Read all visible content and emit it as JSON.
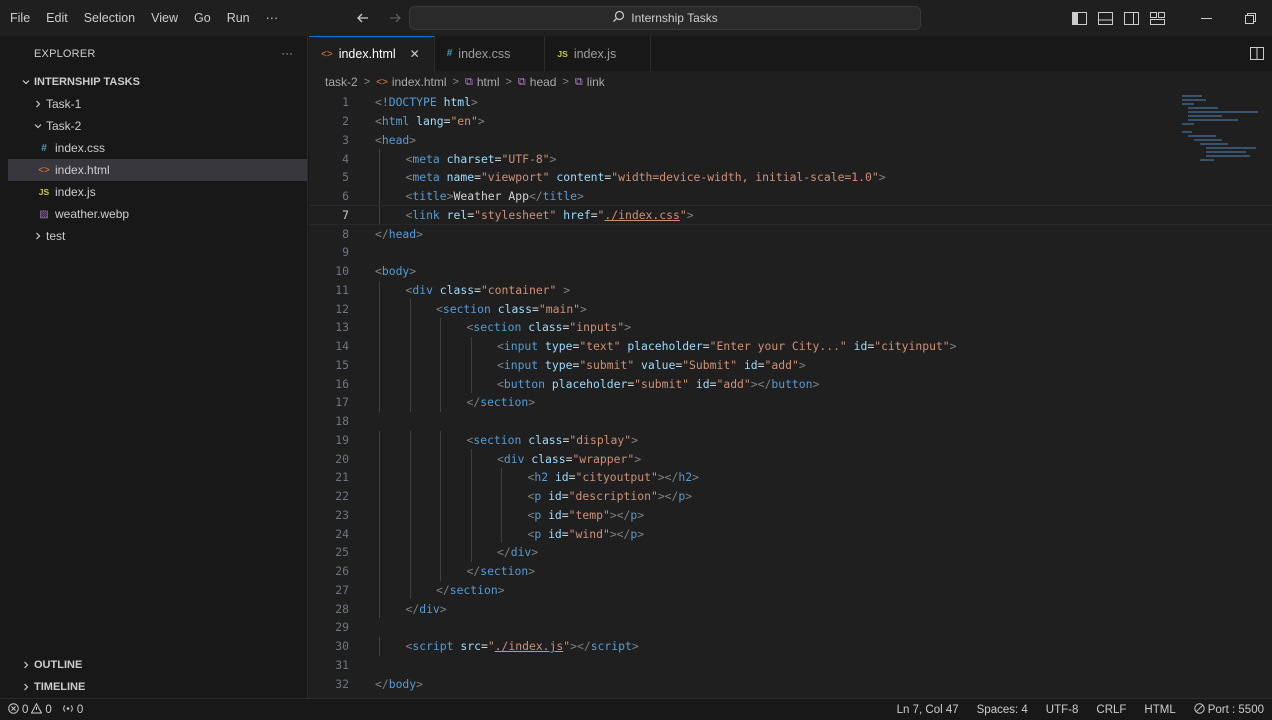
{
  "menu": [
    "File",
    "Edit",
    "Selection",
    "View",
    "Go",
    "Run",
    "···"
  ],
  "command_center": {
    "label": "Internship Tasks"
  },
  "sidebar": {
    "title": "EXPLORER",
    "more": "···",
    "root": "INTERNSHIP TASKS",
    "items": [
      {
        "label": "Task-1",
        "kind": "folder-collapsed",
        "icon": "chevron-right-icon"
      },
      {
        "label": "Task-2",
        "kind": "folder-expanded",
        "icon": "chevron-down-icon"
      },
      {
        "label": "index.css",
        "kind": "file",
        "icon": "css-file-icon",
        "glyph": "#"
      },
      {
        "label": "index.html",
        "kind": "file",
        "icon": "html-file-icon",
        "glyph": "<>",
        "selected": true
      },
      {
        "label": "index.js",
        "kind": "file",
        "icon": "js-file-icon",
        "glyph": "JS"
      },
      {
        "label": "weather.webp",
        "kind": "file",
        "icon": "image-file-icon",
        "glyph": "▨"
      },
      {
        "label": "test",
        "kind": "folder-collapsed",
        "icon": "chevron-right-icon"
      }
    ],
    "outline": "OUTLINE",
    "timeline": "TIMELINE"
  },
  "tabs": [
    {
      "label": "index.html",
      "glyph": "<>",
      "active": true,
      "close": "✕"
    },
    {
      "label": "index.css",
      "glyph": "#",
      "active": false
    },
    {
      "label": "index.js",
      "glyph": "JS",
      "active": false
    }
  ],
  "breadcrumb": [
    "task-2",
    "index.html",
    "html",
    "head",
    "link"
  ],
  "editor": {
    "current_line": 7,
    "lines": [
      {
        "n": "1",
        "indent": 0,
        "segs": [
          [
            "punc",
            "<"
          ],
          [
            "tag",
            "!DOCTYPE "
          ],
          [
            "attr",
            "html"
          ],
          [
            "punc",
            ">"
          ]
        ]
      },
      {
        "n": "2",
        "indent": 0,
        "segs": [
          [
            "punc",
            "<"
          ],
          [
            "tag",
            "html "
          ],
          [
            "attr",
            "lang"
          ],
          [
            "plain",
            "="
          ],
          [
            "str",
            "\"en\""
          ],
          [
            "punc",
            ">"
          ]
        ]
      },
      {
        "n": "3",
        "indent": 0,
        "segs": [
          [
            "punc",
            "<"
          ],
          [
            "tag",
            "head"
          ],
          [
            "punc",
            ">"
          ]
        ]
      },
      {
        "n": "4",
        "indent": 1,
        "segs": [
          [
            "punc",
            "<"
          ],
          [
            "tag",
            "meta "
          ],
          [
            "attr",
            "charset"
          ],
          [
            "plain",
            "="
          ],
          [
            "str",
            "\"UTF-8\""
          ],
          [
            "punc",
            ">"
          ]
        ]
      },
      {
        "n": "5",
        "indent": 1,
        "segs": [
          [
            "punc",
            "<"
          ],
          [
            "tag",
            "meta "
          ],
          [
            "attr",
            "name"
          ],
          [
            "plain",
            "="
          ],
          [
            "str",
            "\"viewport\" "
          ],
          [
            "attr",
            "content"
          ],
          [
            "plain",
            "="
          ],
          [
            "str",
            "\"width=device-width, initial-scale=1.0\""
          ],
          [
            "punc",
            ">"
          ]
        ]
      },
      {
        "n": "6",
        "indent": 1,
        "segs": [
          [
            "punc",
            "<"
          ],
          [
            "tag",
            "title"
          ],
          [
            "punc",
            ">"
          ],
          [
            "plain",
            "Weather App"
          ],
          [
            "punc",
            "</"
          ],
          [
            "tag",
            "title"
          ],
          [
            "punc",
            ">"
          ]
        ]
      },
      {
        "n": "7",
        "indent": 1,
        "segs": [
          [
            "punc",
            "<"
          ],
          [
            "tag",
            "link "
          ],
          [
            "attr",
            "rel"
          ],
          [
            "plain",
            "="
          ],
          [
            "str",
            "\"stylesheet\" "
          ],
          [
            "attr",
            "href"
          ],
          [
            "plain",
            "="
          ],
          [
            "str",
            "\""
          ],
          [
            "strlink",
            "./index.css"
          ],
          [
            "str",
            "\""
          ],
          [
            "punc",
            ">"
          ]
        ]
      },
      {
        "n": "8",
        "indent": 0,
        "segs": [
          [
            "punc",
            "</"
          ],
          [
            "tag",
            "head"
          ],
          [
            "punc",
            ">"
          ]
        ]
      },
      {
        "n": "9",
        "indent": 0,
        "segs": []
      },
      {
        "n": "10",
        "indent": 0,
        "segs": [
          [
            "punc",
            "<"
          ],
          [
            "tag",
            "body"
          ],
          [
            "punc",
            ">"
          ]
        ]
      },
      {
        "n": "11",
        "indent": 1,
        "segs": [
          [
            "punc",
            "<"
          ],
          [
            "tag",
            "div "
          ],
          [
            "attr",
            "class"
          ],
          [
            "plain",
            "="
          ],
          [
            "str",
            "\"container\" "
          ],
          [
            "punc",
            ">"
          ]
        ]
      },
      {
        "n": "12",
        "indent": 2,
        "segs": [
          [
            "punc",
            "<"
          ],
          [
            "tag",
            "section "
          ],
          [
            "attr",
            "class"
          ],
          [
            "plain",
            "="
          ],
          [
            "str",
            "\"main\""
          ],
          [
            "punc",
            ">"
          ]
        ]
      },
      {
        "n": "13",
        "indent": 3,
        "segs": [
          [
            "punc",
            "<"
          ],
          [
            "tag",
            "section "
          ],
          [
            "attr",
            "class"
          ],
          [
            "plain",
            "="
          ],
          [
            "str",
            "\"inputs\""
          ],
          [
            "punc",
            ">"
          ]
        ]
      },
      {
        "n": "14",
        "indent": 4,
        "segs": [
          [
            "punc",
            "<"
          ],
          [
            "tag",
            "input "
          ],
          [
            "attr",
            "type"
          ],
          [
            "plain",
            "="
          ],
          [
            "str",
            "\"text\" "
          ],
          [
            "attr",
            "placeholder"
          ],
          [
            "plain",
            "="
          ],
          [
            "str",
            "\"Enter your City...\" "
          ],
          [
            "attr",
            "id"
          ],
          [
            "plain",
            "="
          ],
          [
            "str",
            "\"cityinput\""
          ],
          [
            "punc",
            ">"
          ]
        ]
      },
      {
        "n": "15",
        "indent": 4,
        "segs": [
          [
            "punc",
            "<"
          ],
          [
            "tag",
            "input "
          ],
          [
            "attr",
            "type"
          ],
          [
            "plain",
            "="
          ],
          [
            "str",
            "\"submit\" "
          ],
          [
            "attr",
            "value"
          ],
          [
            "plain",
            "="
          ],
          [
            "str",
            "\"Submit\" "
          ],
          [
            "attr",
            "id"
          ],
          [
            "plain",
            "="
          ],
          [
            "str",
            "\"add\""
          ],
          [
            "punc",
            ">"
          ]
        ]
      },
      {
        "n": "16",
        "indent": 4,
        "segs": [
          [
            "punc",
            "<"
          ],
          [
            "tag",
            "button "
          ],
          [
            "attr",
            "placeholder"
          ],
          [
            "plain",
            "="
          ],
          [
            "str",
            "\"submit\" "
          ],
          [
            "attr",
            "id"
          ],
          [
            "plain",
            "="
          ],
          [
            "str",
            "\"add\""
          ],
          [
            "punc",
            "></"
          ],
          [
            "tag",
            "button"
          ],
          [
            "punc",
            ">"
          ]
        ]
      },
      {
        "n": "17",
        "indent": 3,
        "segs": [
          [
            "punc",
            "</"
          ],
          [
            "tag",
            "section"
          ],
          [
            "punc",
            ">"
          ]
        ]
      },
      {
        "n": "18",
        "indent": 0,
        "segs": []
      },
      {
        "n": "19",
        "indent": 3,
        "segs": [
          [
            "punc",
            "<"
          ],
          [
            "tag",
            "section "
          ],
          [
            "attr",
            "class"
          ],
          [
            "plain",
            "="
          ],
          [
            "str",
            "\"display\""
          ],
          [
            "punc",
            ">"
          ]
        ]
      },
      {
        "n": "20",
        "indent": 4,
        "segs": [
          [
            "punc",
            "<"
          ],
          [
            "tag",
            "div "
          ],
          [
            "attr",
            "class"
          ],
          [
            "plain",
            "="
          ],
          [
            "str",
            "\"wrapper\""
          ],
          [
            "punc",
            ">"
          ]
        ]
      },
      {
        "n": "21",
        "indent": 5,
        "segs": [
          [
            "punc",
            "<"
          ],
          [
            "tag",
            "h2 "
          ],
          [
            "attr",
            "id"
          ],
          [
            "plain",
            "="
          ],
          [
            "str",
            "\"cityoutput\""
          ],
          [
            "punc",
            "></"
          ],
          [
            "tag",
            "h2"
          ],
          [
            "punc",
            ">"
          ]
        ]
      },
      {
        "n": "22",
        "indent": 5,
        "segs": [
          [
            "punc",
            "<"
          ],
          [
            "tag",
            "p "
          ],
          [
            "attr",
            "id"
          ],
          [
            "plain",
            "="
          ],
          [
            "str",
            "\"description\""
          ],
          [
            "punc",
            "></"
          ],
          [
            "tag",
            "p"
          ],
          [
            "punc",
            ">"
          ]
        ]
      },
      {
        "n": "23",
        "indent": 5,
        "segs": [
          [
            "punc",
            "<"
          ],
          [
            "tag",
            "p "
          ],
          [
            "attr",
            "id"
          ],
          [
            "plain",
            "="
          ],
          [
            "str",
            "\"temp\""
          ],
          [
            "punc",
            "></"
          ],
          [
            "tag",
            "p"
          ],
          [
            "punc",
            ">"
          ]
        ]
      },
      {
        "n": "24",
        "indent": 5,
        "segs": [
          [
            "punc",
            "<"
          ],
          [
            "tag",
            "p "
          ],
          [
            "attr",
            "id"
          ],
          [
            "plain",
            "="
          ],
          [
            "str",
            "\"wind\""
          ],
          [
            "punc",
            "></"
          ],
          [
            "tag",
            "p"
          ],
          [
            "punc",
            ">"
          ]
        ]
      },
      {
        "n": "25",
        "indent": 4,
        "segs": [
          [
            "punc",
            "</"
          ],
          [
            "tag",
            "div"
          ],
          [
            "punc",
            ">"
          ]
        ]
      },
      {
        "n": "26",
        "indent": 3,
        "segs": [
          [
            "punc",
            "</"
          ],
          [
            "tag",
            "section"
          ],
          [
            "punc",
            ">"
          ]
        ]
      },
      {
        "n": "27",
        "indent": 2,
        "segs": [
          [
            "punc",
            "</"
          ],
          [
            "tag",
            "section"
          ],
          [
            "punc",
            ">"
          ]
        ]
      },
      {
        "n": "28",
        "indent": 1,
        "segs": [
          [
            "punc",
            "</"
          ],
          [
            "tag",
            "div"
          ],
          [
            "punc",
            ">"
          ]
        ]
      },
      {
        "n": "29",
        "indent": 0,
        "segs": []
      },
      {
        "n": "30",
        "indent": 1,
        "segs": [
          [
            "punc",
            "<"
          ],
          [
            "tag",
            "script "
          ],
          [
            "attr",
            "src"
          ],
          [
            "plain",
            "="
          ],
          [
            "str",
            "\""
          ],
          [
            "strlink",
            "./index.js"
          ],
          [
            "str",
            "\""
          ],
          [
            "punc",
            "></"
          ],
          [
            "tag",
            "script"
          ],
          [
            "punc",
            ">"
          ]
        ]
      },
      {
        "n": "31",
        "indent": 0,
        "segs": []
      },
      {
        "n": "32",
        "indent": 0,
        "segs": [
          [
            "punc",
            "</"
          ],
          [
            "tag",
            "body"
          ],
          [
            "punc",
            ">"
          ]
        ]
      }
    ]
  },
  "status": {
    "errors": "0",
    "warnings": "0",
    "ports": "0",
    "position": "Ln 7, Col 47",
    "spaces": "Spaces: 4",
    "encoding": "UTF-8",
    "eol": "CRLF",
    "language": "HTML",
    "port": "Port : 5500"
  },
  "colors": {
    "tag": "#569cd6",
    "attr": "#9cdcfe",
    "string": "#ce9178",
    "text": "#d4d4d4",
    "accent": "#0078d4"
  }
}
